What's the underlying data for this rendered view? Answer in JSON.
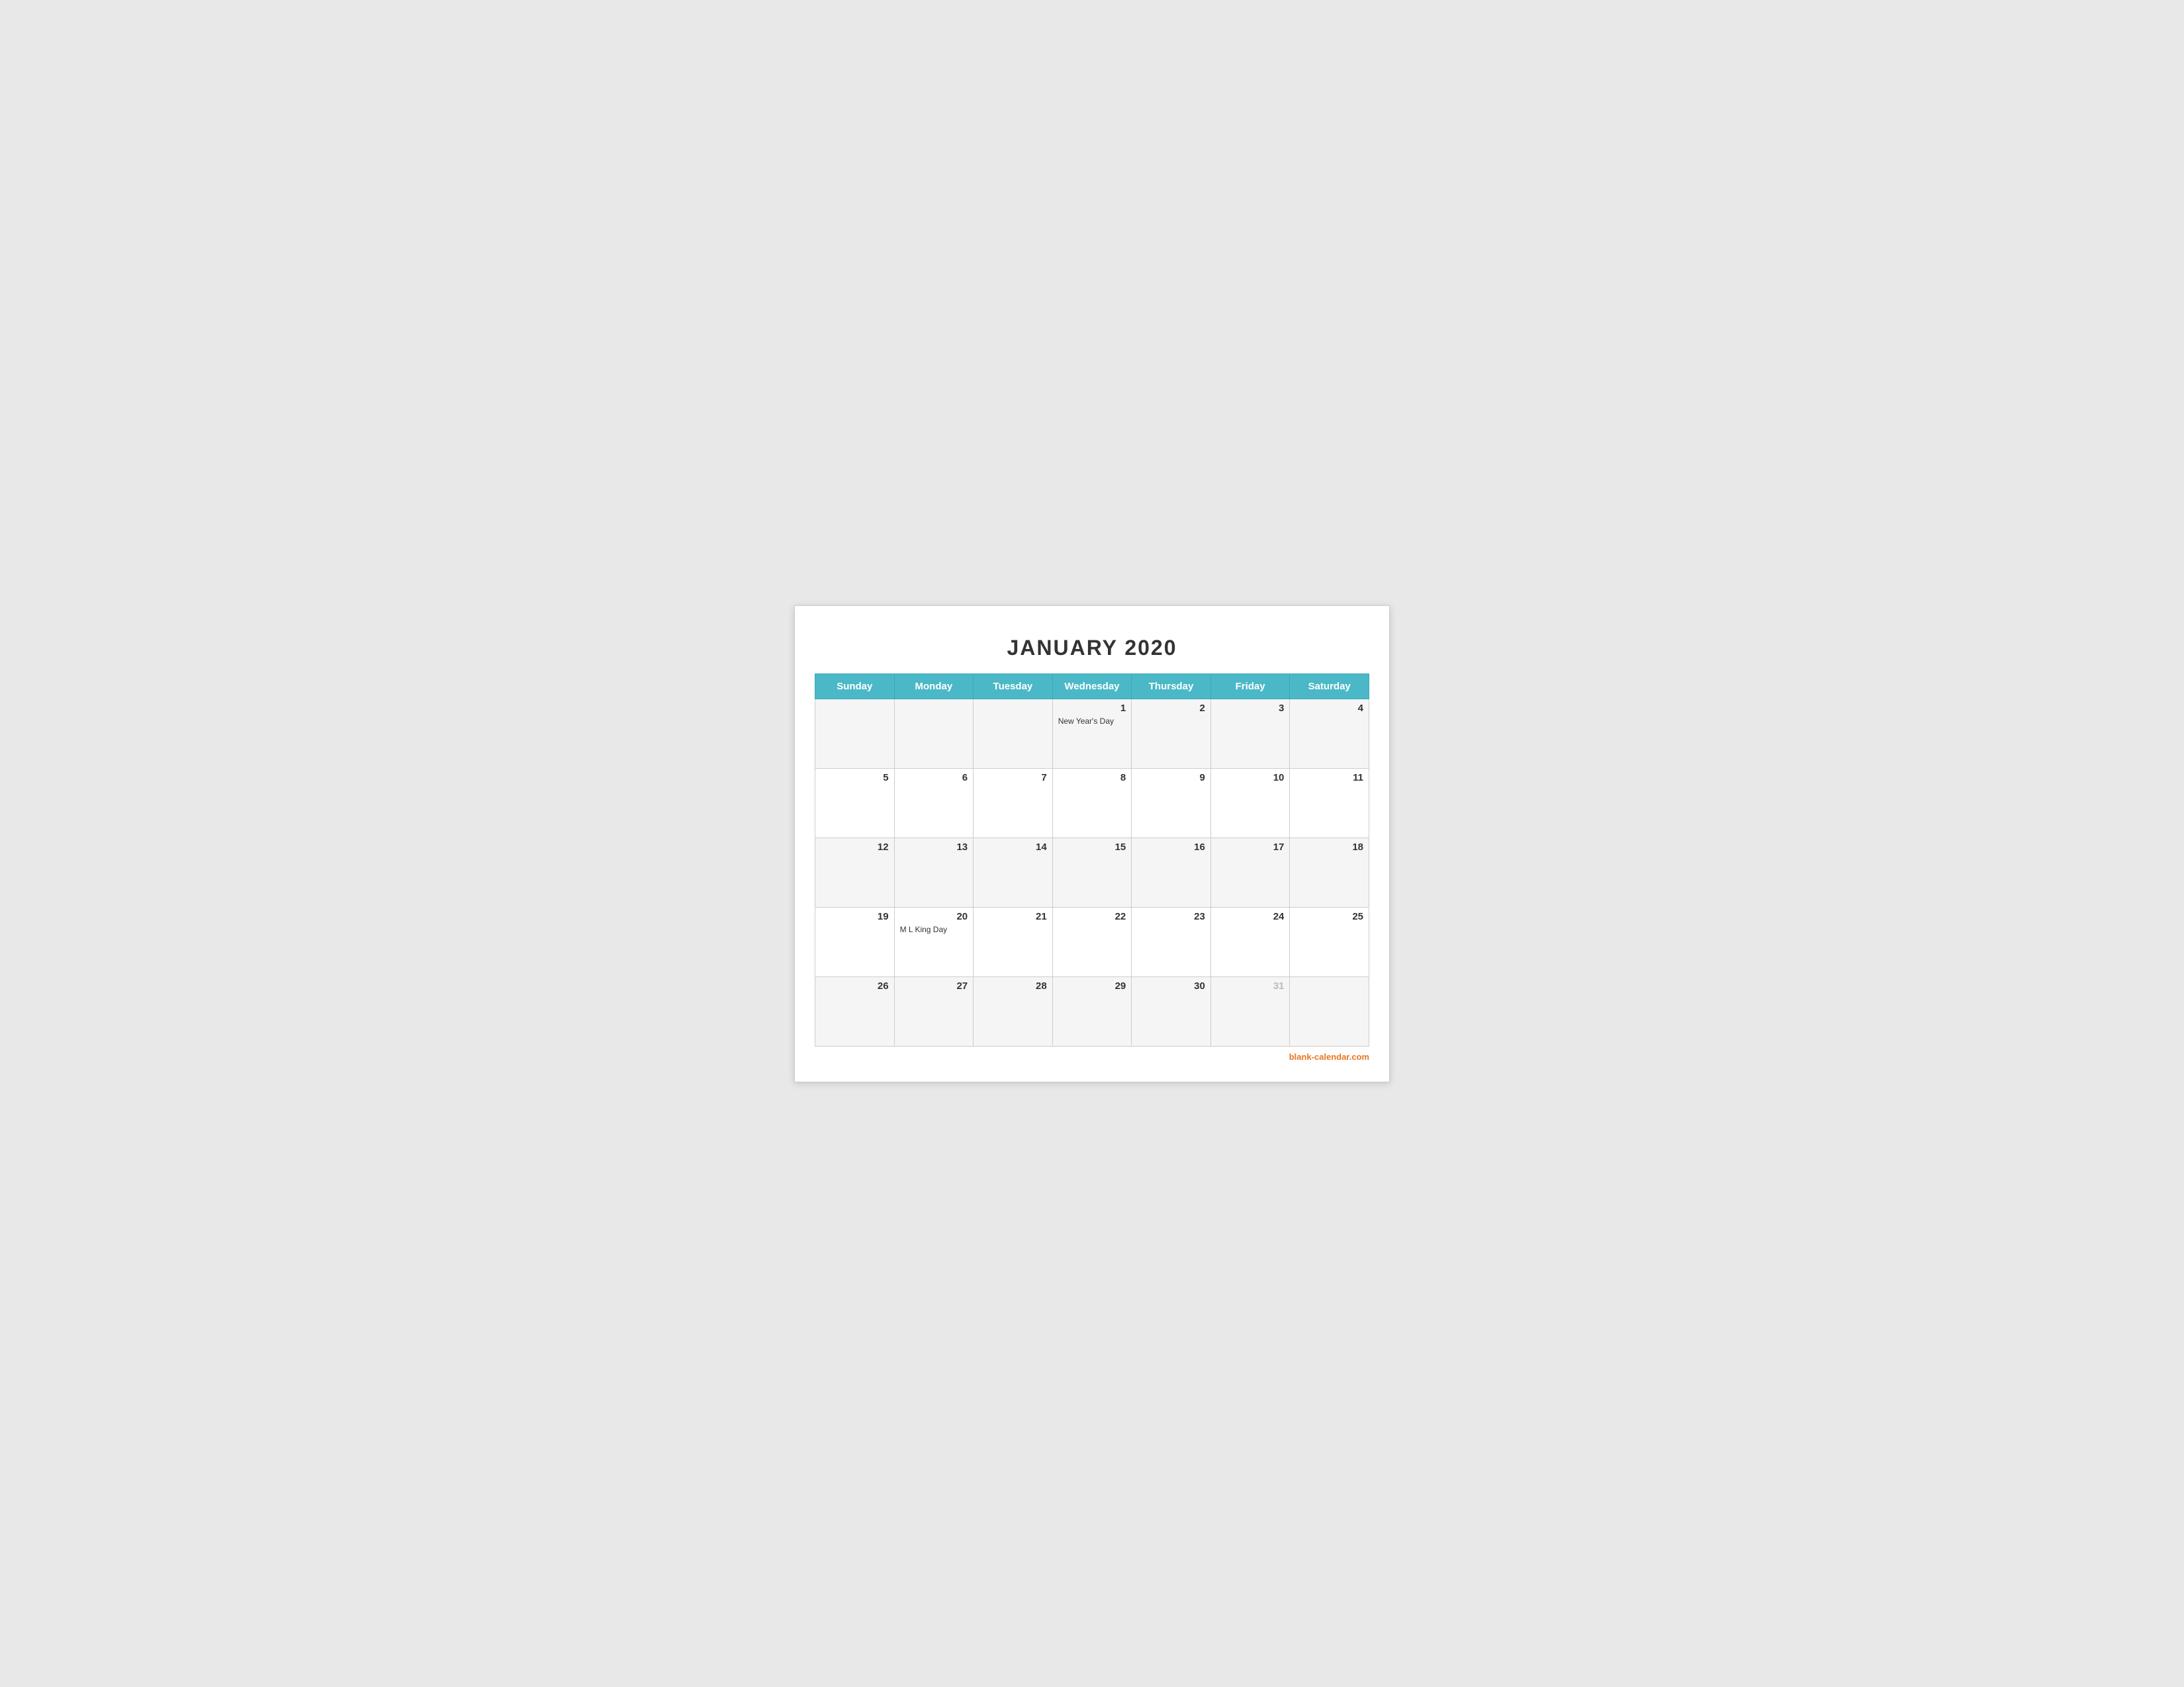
{
  "title": "JANUARY 2020",
  "header": {
    "days": [
      "Sunday",
      "Monday",
      "Tuesday",
      "Wednesday",
      "Thursday",
      "Friday",
      "Saturday"
    ]
  },
  "weeks": [
    {
      "days": [
        {
          "number": "",
          "holiday": ""
        },
        {
          "number": "",
          "holiday": ""
        },
        {
          "number": "",
          "holiday": ""
        },
        {
          "number": "1",
          "holiday": "New Year's Day"
        },
        {
          "number": "2",
          "holiday": ""
        },
        {
          "number": "3",
          "holiday": ""
        },
        {
          "number": "4",
          "holiday": ""
        }
      ]
    },
    {
      "days": [
        {
          "number": "5",
          "holiday": ""
        },
        {
          "number": "6",
          "holiday": ""
        },
        {
          "number": "7",
          "holiday": ""
        },
        {
          "number": "8",
          "holiday": ""
        },
        {
          "number": "9",
          "holiday": ""
        },
        {
          "number": "10",
          "holiday": ""
        },
        {
          "number": "11",
          "holiday": ""
        }
      ]
    },
    {
      "days": [
        {
          "number": "12",
          "holiday": ""
        },
        {
          "number": "13",
          "holiday": ""
        },
        {
          "number": "14",
          "holiday": ""
        },
        {
          "number": "15",
          "holiday": ""
        },
        {
          "number": "16",
          "holiday": ""
        },
        {
          "number": "17",
          "holiday": ""
        },
        {
          "number": "18",
          "holiday": ""
        }
      ]
    },
    {
      "days": [
        {
          "number": "19",
          "holiday": ""
        },
        {
          "number": "20",
          "holiday": "M L King Day"
        },
        {
          "number": "21",
          "holiday": ""
        },
        {
          "number": "22",
          "holiday": ""
        },
        {
          "number": "23",
          "holiday": ""
        },
        {
          "number": "24",
          "holiday": ""
        },
        {
          "number": "25",
          "holiday": ""
        }
      ]
    },
    {
      "days": [
        {
          "number": "26",
          "holiday": ""
        },
        {
          "number": "27",
          "holiday": ""
        },
        {
          "number": "28",
          "holiday": ""
        },
        {
          "number": "29",
          "holiday": ""
        },
        {
          "number": "30",
          "holiday": ""
        },
        {
          "number": "31",
          "holiday": "",
          "grayed": true
        },
        {
          "number": "",
          "holiday": ""
        }
      ]
    }
  ],
  "footer": {
    "text": "blank-calendar.com",
    "url": "blank-calendar.com"
  }
}
